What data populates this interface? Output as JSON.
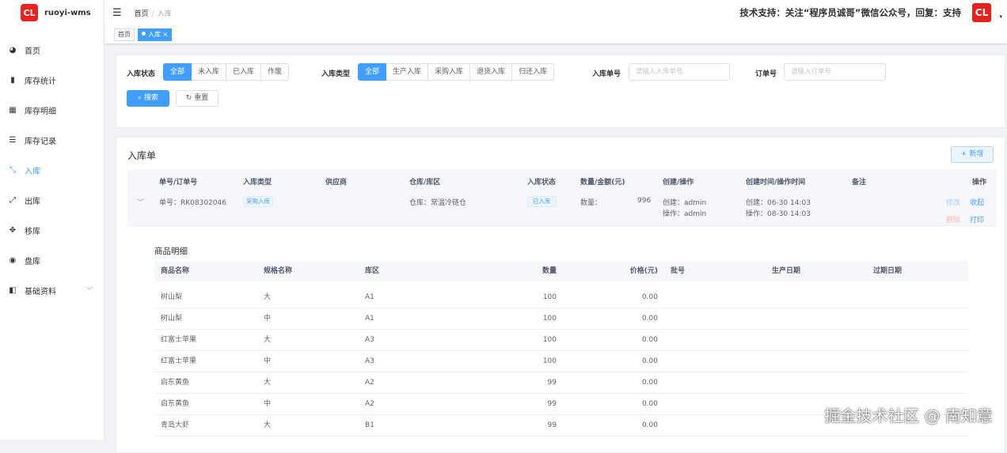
{
  "app": {
    "logo_text": "CL",
    "name": "ruoyi-wms"
  },
  "sidebar": {
    "items": [
      {
        "label": "首页",
        "icon": "dashboard-icon",
        "glyph": "◕"
      },
      {
        "label": "库存统计",
        "icon": "bar-chart-icon",
        "glyph": "▮"
      },
      {
        "label": "库存明细",
        "icon": "table-icon",
        "glyph": "▦"
      },
      {
        "label": "库存记录",
        "icon": "list-icon",
        "glyph": "☰"
      },
      {
        "label": "入库",
        "icon": "inbound-icon",
        "glyph": "⤡"
      },
      {
        "label": "出库",
        "icon": "outbound-icon",
        "glyph": "⤢"
      },
      {
        "label": "移库",
        "icon": "move-icon",
        "glyph": "✥"
      },
      {
        "label": "盘库",
        "icon": "check-icon",
        "glyph": "◉"
      },
      {
        "label": "基础资料",
        "icon": "book-icon",
        "glyph": "◧"
      }
    ],
    "expand_glyph": "﹀"
  },
  "navbar": {
    "hamburger": "☰",
    "breadcrumb": [
      "首页",
      "入库"
    ],
    "breadcrumb_sep": "/",
    "support": "技术支持：关注“程序员诚哥”微信公众号，回复：支持",
    "avatar_text": "CL",
    "caret": "▾"
  },
  "tags": [
    {
      "label": "首页"
    },
    {
      "label": "入库",
      "close": "×"
    }
  ],
  "search": {
    "status_label": "入库状态",
    "status_options": [
      "全部",
      "未入库",
      "已入库",
      "作废"
    ],
    "type_label": "入库类型",
    "type_options": [
      "全部",
      "生产入库",
      "采购入库",
      "退货入库",
      "归还入库"
    ],
    "no_label": "入库单号",
    "no_placeholder": "请输入入库单号",
    "order_label": "订单号",
    "order_placeholder": "请输入订单号",
    "search_btn": "搜索",
    "reset_btn": "重置",
    "search_icon": "⌕",
    "reset_icon": "↻"
  },
  "list": {
    "title": "入库单",
    "add_btn": "新增",
    "add_icon": "+",
    "columns": [
      "单号/订单号",
      "入库类型",
      "供应商",
      "仓库/库区",
      "入库状态",
      "数量/金额(元)",
      "创建/操作",
      "创建时间/操作时间",
      "备注",
      "操作"
    ],
    "row": {
      "expand": "﹀",
      "order_no": "单号：RK08302046",
      "type": "采购入库",
      "warehouse": "仓库：常温冷链仓",
      "status": "已入库",
      "qty_label": "数量：",
      "qty_value": "996",
      "created_by": "创建：admin",
      "operated_by": "操作：admin",
      "created_at": "创建：06-30 14:03",
      "operated_at": "操作：08-30 14:03",
      "actions": {
        "edit": "修改",
        "collapse": "收起",
        "delete": "删除",
        "print": "打印"
      }
    }
  },
  "detail": {
    "title": "商品明细",
    "columns": [
      "商品名称",
      "规格名称",
      "库区",
      "数量",
      "价格(元)",
      "批号",
      "生产日期",
      "过期日期"
    ],
    "rows": [
      [
        "树山梨",
        "大",
        "A1",
        "100",
        "0.00"
      ],
      [
        "树山梨",
        "中",
        "A1",
        "100",
        "0.00"
      ],
      [
        "红富士苹果",
        "大",
        "A3",
        "100",
        "0.00"
      ],
      [
        "红富士苹果",
        "中",
        "A3",
        "100",
        "0.00"
      ],
      [
        "启东黄鱼",
        "大",
        "A2",
        "99",
        "0.00"
      ],
      [
        "启东黄鱼",
        "中",
        "A2",
        "99",
        "0.00"
      ],
      [
        "青岛大虾",
        "大",
        "B1",
        "99",
        "0.00"
      ]
    ]
  },
  "watermark": "掘金技术社区 @ 南知意"
}
